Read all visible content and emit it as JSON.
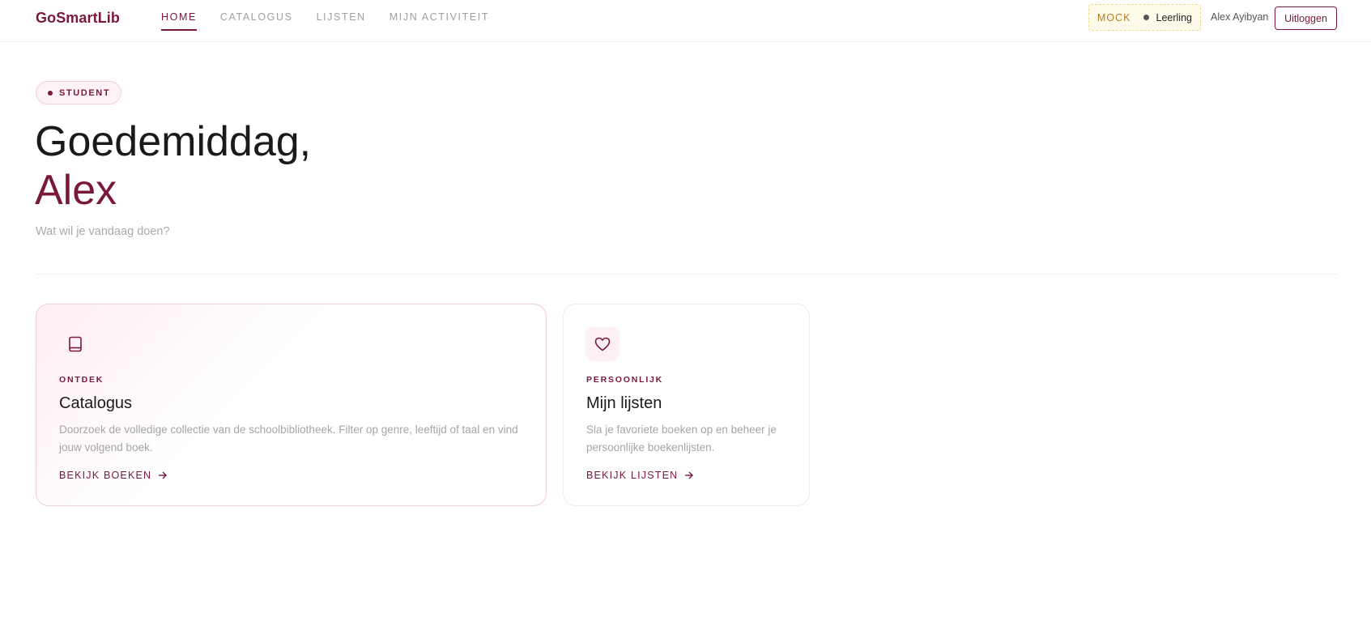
{
  "app": {
    "logo": "GoSmartLib"
  },
  "nav": {
    "items": [
      {
        "label": "HOME",
        "active": true
      },
      {
        "label": "CATALOGUS",
        "active": false
      },
      {
        "label": "LIJSTEN",
        "active": false
      },
      {
        "label": "MIJN ACTIVITEIT",
        "active": false
      }
    ]
  },
  "header": {
    "mock_label": "MOCK",
    "mock_role": "Leerling",
    "user_name": "Alex Ayibyan",
    "logout_label": "Uitloggen"
  },
  "hero": {
    "role_badge": "STUDENT",
    "greeting": "Goedemiddag,",
    "name": "Alex",
    "subtitle": "Wat wil je vandaag doen?"
  },
  "cards": [
    {
      "icon": "book-icon",
      "eyebrow": "ONTDEK",
      "title": "Catalogus",
      "description": "Doorzoek de volledige collectie van de schoolbibliotheek. Filter op genre, leeftijd of taal en vind jouw volgend boek.",
      "link": "BEKIJK BOEKEN"
    },
    {
      "icon": "heart-icon",
      "eyebrow": "PERSOONLIJK",
      "title": "Mijn lijsten",
      "description": "Sla je favoriete boeken op en beheer je persoonlijke boekenlijsten.",
      "link": "BEKIJK LIJSTEN"
    }
  ],
  "colors": {
    "accent": "#7a1838",
    "muted_text": "#a5a5a5",
    "mock_bg": "#fffbeb",
    "mock_border": "#f0d690"
  }
}
